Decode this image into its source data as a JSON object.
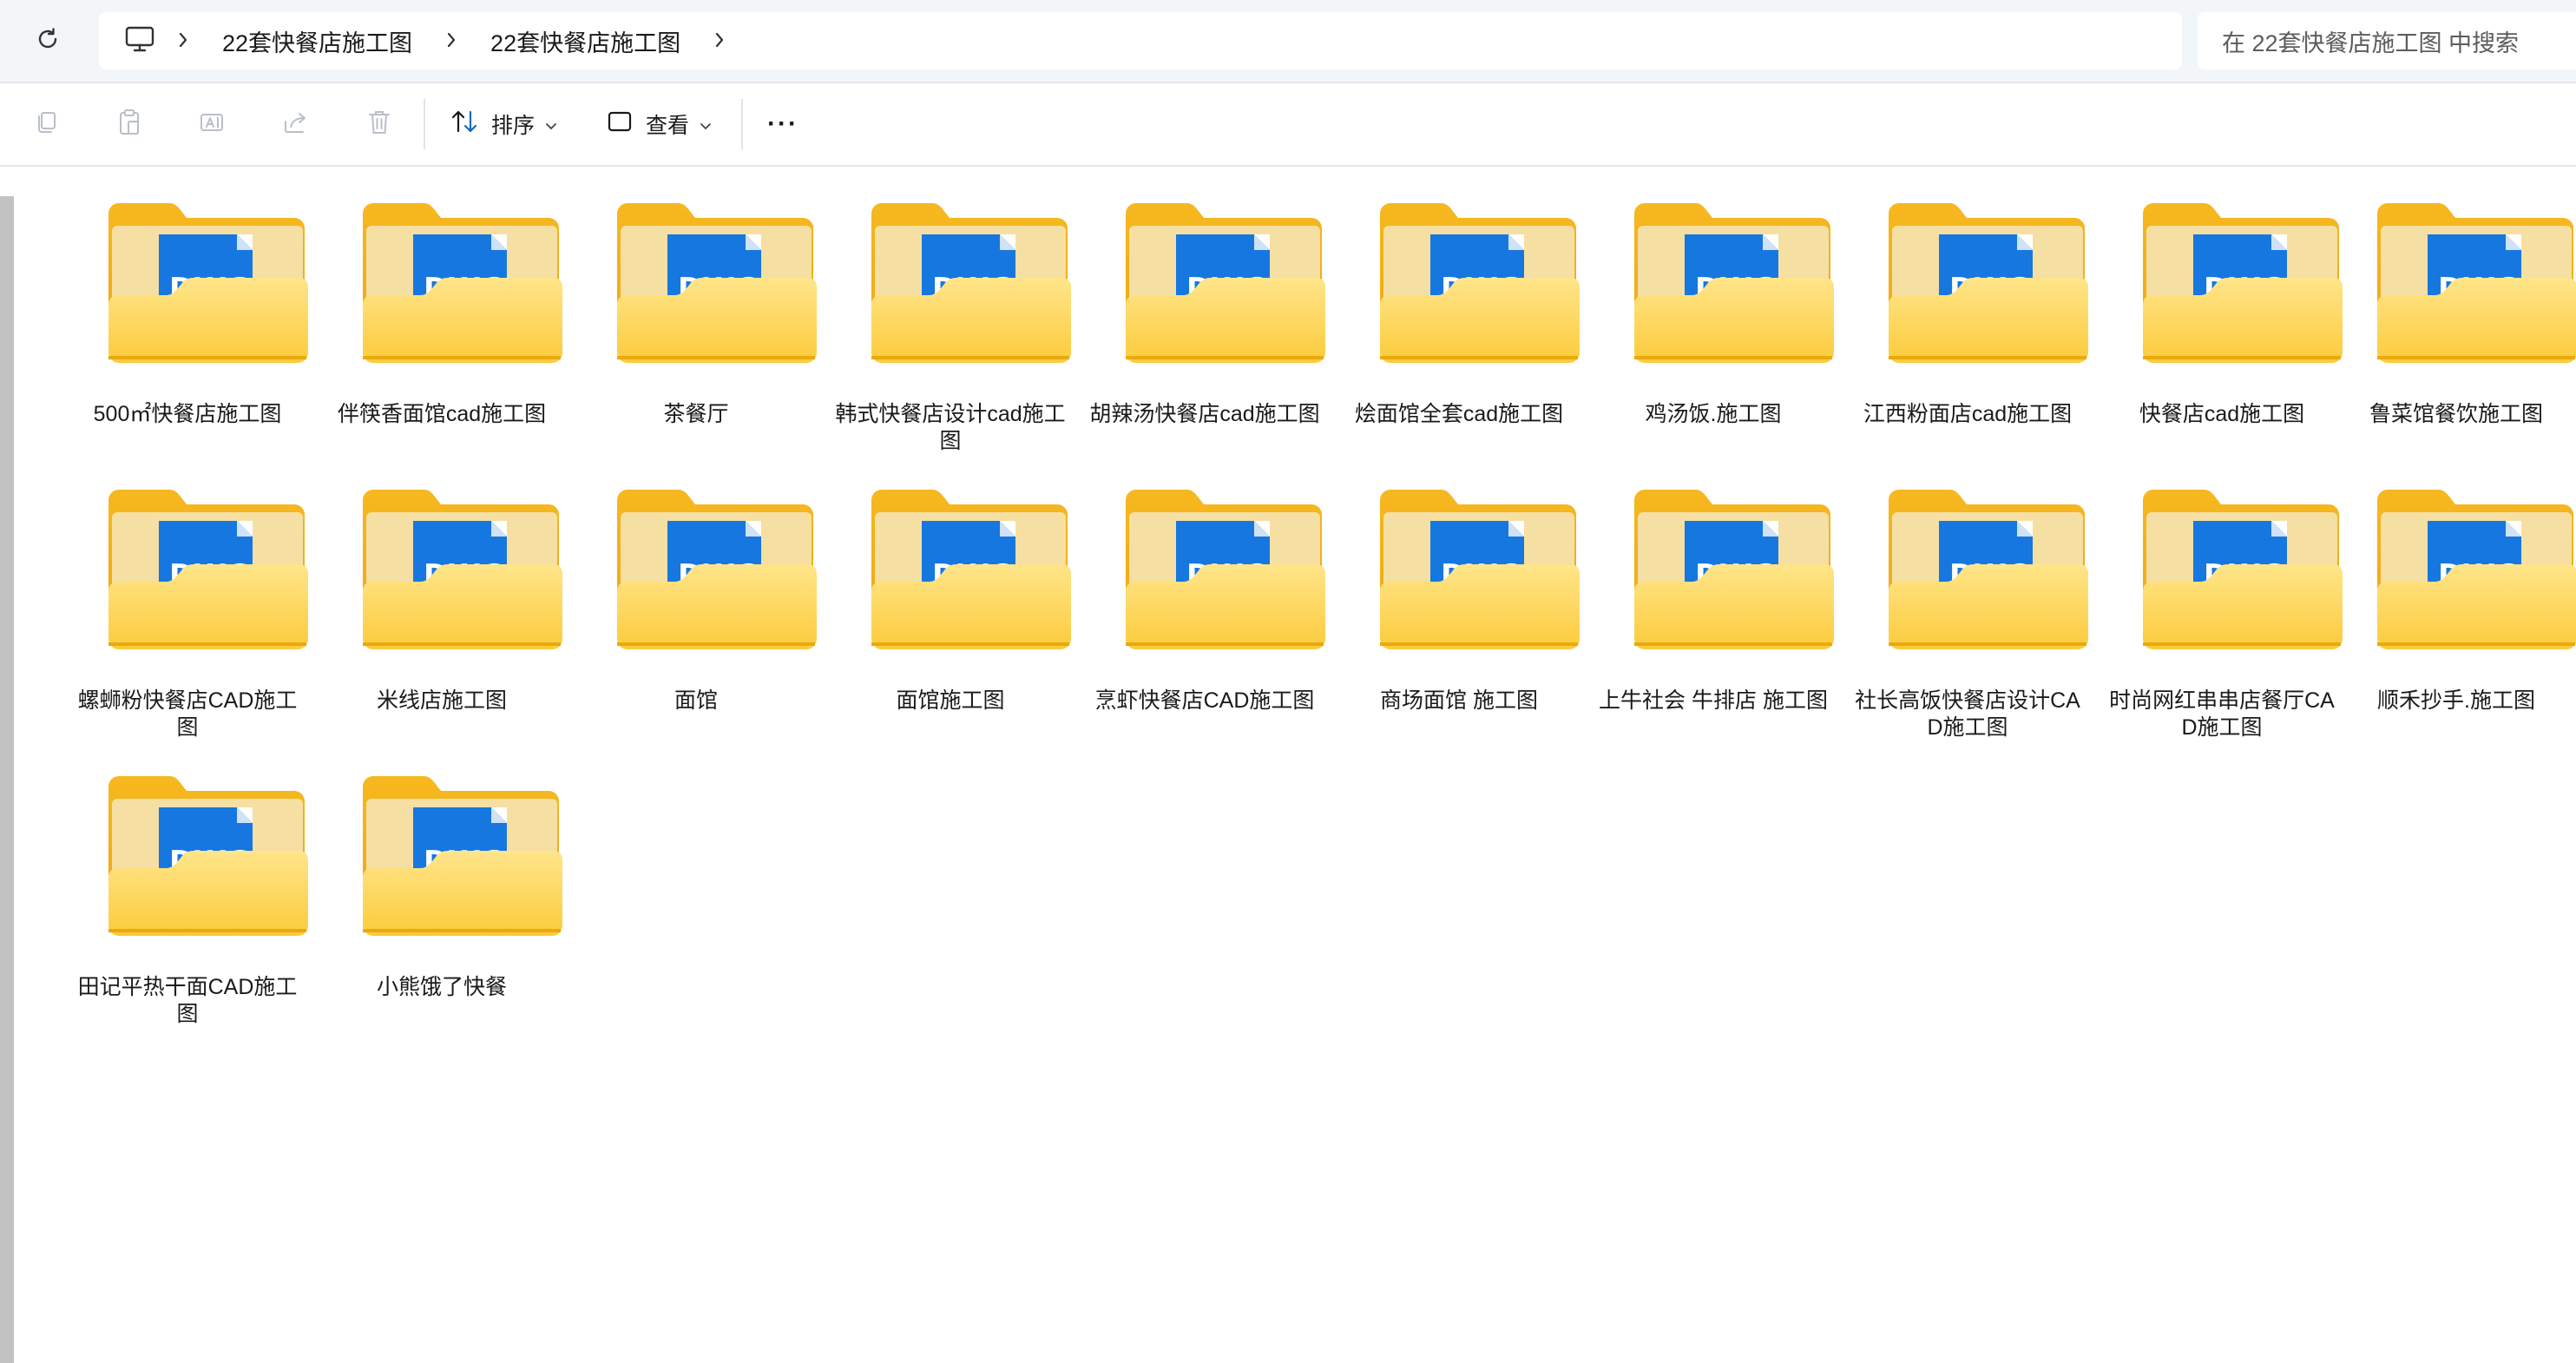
{
  "address_bar": {
    "breadcrumbs": [
      "22套快餐店施工图",
      "22套快餐店施工图"
    ],
    "search_placeholder": "在 22套快餐店施工图 中搜索"
  },
  "toolbar": {
    "icons": [
      "copy-icon",
      "paste-icon",
      "rename-icon",
      "share-icon",
      "delete-icon"
    ],
    "sort_label": "排序",
    "view_label": "查看",
    "more_label": "···"
  },
  "folders": [
    {
      "name": "500㎡快餐店施工图"
    },
    {
      "name": "伴筷香面馆cad施工图"
    },
    {
      "name": "茶餐厅"
    },
    {
      "name": "韩式快餐店设计cad施工图"
    },
    {
      "name": "胡辣汤快餐店cad施工图"
    },
    {
      "name": "烩面馆全套cad施工图"
    },
    {
      "name": "鸡汤饭.施工图"
    },
    {
      "name": "江西粉面店cad施工图"
    },
    {
      "name": "快餐店cad施工图"
    },
    {
      "name": "鲁菜馆餐饮施工图"
    },
    {
      "name": "螺蛳粉快餐店CAD施工图"
    },
    {
      "name": "米线店施工图"
    },
    {
      "name": "面馆"
    },
    {
      "name": "面馆施工图"
    },
    {
      "name": "烹虾快餐店CAD施工图"
    },
    {
      "name": "商场面馆 施工图"
    },
    {
      "name": "上牛社会 牛排店 施工图"
    },
    {
      "name": "社长高饭快餐店设计CAD施工图"
    },
    {
      "name": "时尚网红串串店餐厅CAD施工图"
    },
    {
      "name": "顺禾抄手.施工图"
    },
    {
      "name": "田记平热干面CAD施工图"
    },
    {
      "name": "小熊饿了快餐"
    }
  ]
}
